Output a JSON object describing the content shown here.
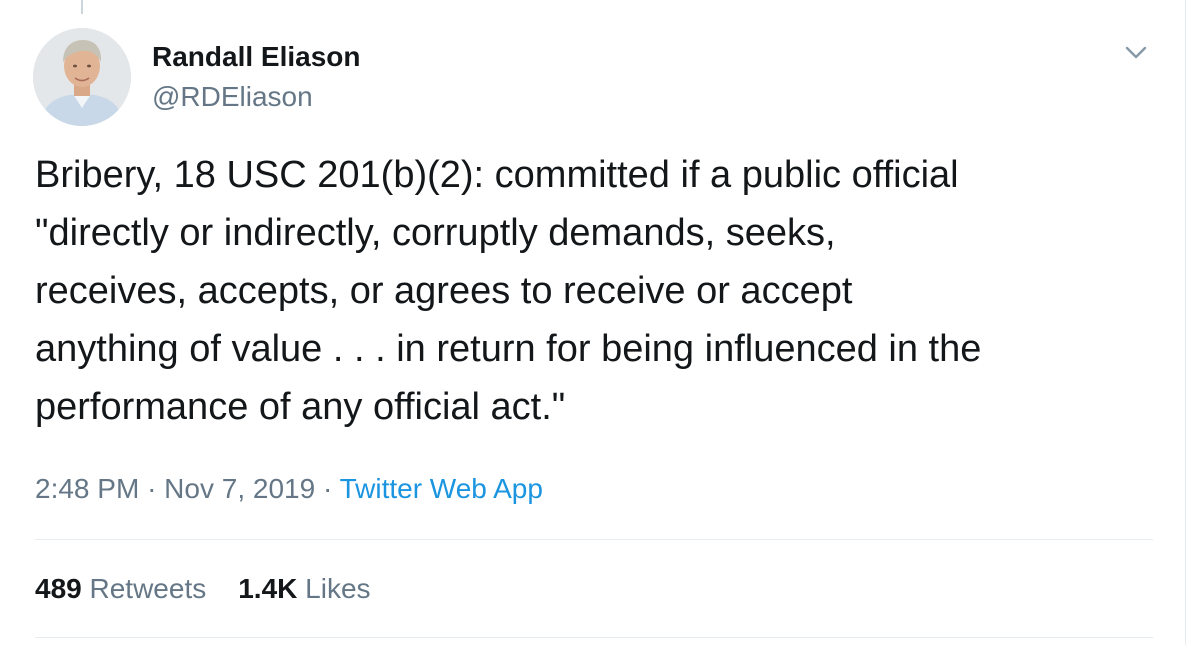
{
  "author": {
    "name": "Randall Eliason",
    "handle": "@RDEliason",
    "avatar": "avatar-photo"
  },
  "tweet": {
    "lines": [
      "Bribery, 18 USC 201(b)(2): committed if a public official",
      "\"directly or indirectly, corruptly demands, seeks,",
      "receives, accepts, or agrees to receive or accept",
      "anything of value . . . in return for being influenced in the",
      "performance of any official act.\""
    ]
  },
  "meta": {
    "time": "2:48 PM",
    "separator": "·",
    "date": "Nov 7, 2019",
    "source": "Twitter Web App"
  },
  "stats": {
    "retweets_count": "489",
    "retweets_label": "Retweets",
    "likes_count": "1.4K",
    "likes_label": "Likes"
  },
  "icons": {
    "menu": "chevron-down-icon"
  },
  "colors": {
    "text": "#14171a",
    "secondary": "#657786",
    "link": "#1b95e0",
    "border": "#e6ecf0"
  }
}
